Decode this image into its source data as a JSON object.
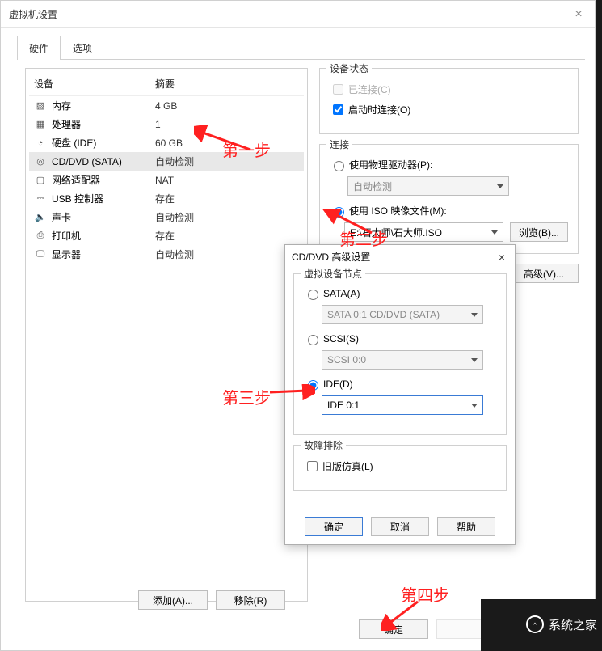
{
  "window": {
    "title": "虚拟机设置",
    "close": "×"
  },
  "tabs": {
    "hardware": "硬件",
    "options": "选项"
  },
  "device_header": {
    "device": "设备",
    "summary": "摘要"
  },
  "devices": [
    {
      "icon": "memory-icon",
      "glyph": "▧",
      "name": "内存",
      "summary": "4 GB"
    },
    {
      "icon": "cpu-icon",
      "glyph": "▦",
      "name": "处理器",
      "summary": "1"
    },
    {
      "icon": "disk-icon",
      "glyph": "◔",
      "name": "硬盘 (IDE)",
      "summary": "60 GB"
    },
    {
      "icon": "cd-icon",
      "glyph": "◎",
      "name": "CD/DVD (SATA)",
      "summary": "自动检测"
    },
    {
      "icon": "network-icon",
      "glyph": "▢",
      "name": "网络适配器",
      "summary": "NAT"
    },
    {
      "icon": "usb-icon",
      "glyph": "⎓",
      "name": "USB 控制器",
      "summary": "存在"
    },
    {
      "icon": "sound-icon",
      "glyph": "🔈",
      "name": "声卡",
      "summary": "自动检测"
    },
    {
      "icon": "printer-icon",
      "glyph": "⎙",
      "name": "打印机",
      "summary": "存在"
    },
    {
      "icon": "display-icon",
      "glyph": "🖵",
      "name": "显示器",
      "summary": "自动检测"
    }
  ],
  "status_group": {
    "legend": "设备状态",
    "connected": "已连接(C)",
    "connect_poweron": "启动时连接(O)"
  },
  "conn_group": {
    "legend": "连接",
    "physical": "使用物理驱动器(P):",
    "physical_combo": "自动检测",
    "iso": "使用 ISO 映像文件(M):",
    "iso_path": "E:\\石大师\\石大师.ISO",
    "browse": "浏览(B)...",
    "advanced": "高级(V)..."
  },
  "dialog2": {
    "title": "CD/DVD 高级设置",
    "close": "×",
    "node_group": "虚拟设备节点",
    "sata": "SATA(A)",
    "sata_combo": "SATA 0:1   CD/DVD (SATA)",
    "scsi": "SCSI(S)",
    "scsi_combo": "SCSI 0:0",
    "ide": "IDE(D)",
    "ide_combo": "IDE 0:1",
    "trouble_group": "故障排除",
    "legacy": "旧版仿真(L)",
    "ok": "确定",
    "cancel": "取消",
    "help": "帮助"
  },
  "main_buttons": {
    "add": "添加(A)...",
    "remove": "移除(R)"
  },
  "footer": {
    "ok": "确定",
    "cancel": "",
    "help": ""
  },
  "annotations": {
    "step1": "第一步",
    "step2": "第二步",
    "step3": "第三步",
    "step4": "第四步"
  },
  "watermark": {
    "brand": "系统之家"
  }
}
